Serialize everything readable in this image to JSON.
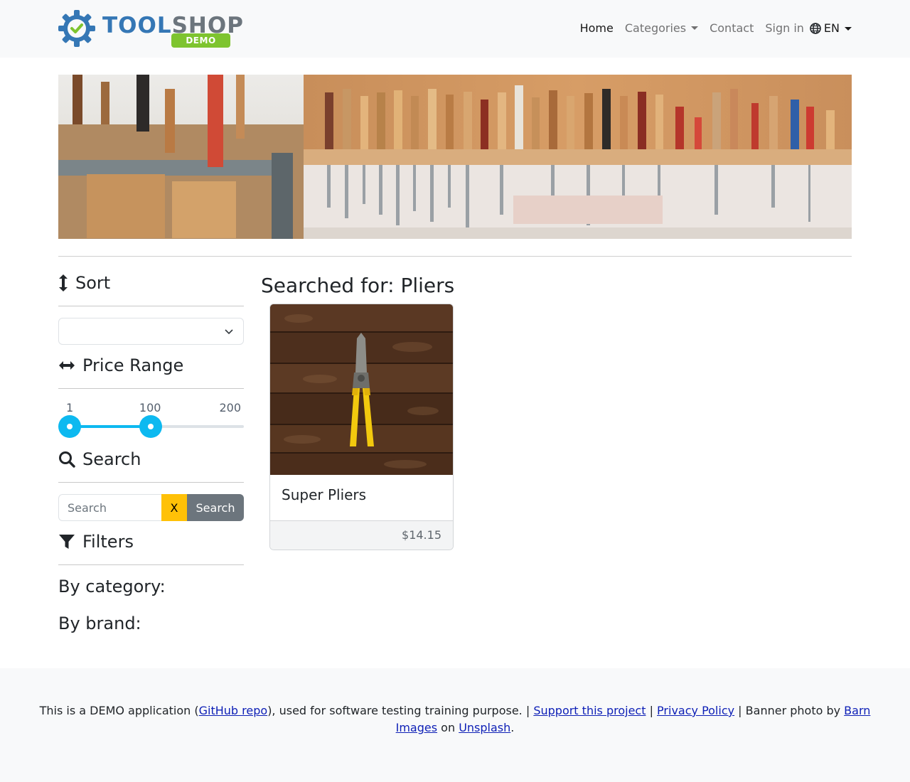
{
  "navbar": {
    "brand_text_1": "TOOL",
    "brand_text_2": "SHOP",
    "brand_badge": "DEMO",
    "links": {
      "home": "Home",
      "categories": "Categories",
      "contact": "Contact",
      "sign_in": "Sign in"
    },
    "language": "EN"
  },
  "sidebar": {
    "sort": {
      "heading": "Sort",
      "selected": ""
    },
    "price_range": {
      "heading": "Price Range",
      "min_label": "1",
      "max_label": "200",
      "current_label": "100",
      "range_min": 1,
      "range_max": 200,
      "selected_low": 1,
      "selected_high": 100
    },
    "search": {
      "heading": "Search",
      "placeholder": "Search",
      "value": "",
      "clear_label": "X",
      "submit_label": "Search"
    },
    "filters": {
      "heading": "Filters",
      "by_category": "By category:",
      "by_brand": "By brand:"
    }
  },
  "results": {
    "title": "Searched for: Pliers",
    "products": [
      {
        "name": "Super Pliers",
        "price": "$14.15"
      }
    ]
  },
  "footer": {
    "text_1": "This is a DEMO application (",
    "link_github": "GitHub repo",
    "text_2": "), used for software testing training purpose. | ",
    "link_support": "Support this project",
    "text_3": " | ",
    "link_privacy": "Privacy Policy",
    "text_4": " | Banner photo by ",
    "link_barn": "Barn Images",
    "text_5": " on ",
    "link_unsplash": "Unsplash",
    "text_6": "."
  },
  "colors": {
    "accent": "#0db9f0",
    "brand_blue": "#3577b5",
    "brand_green": "#7ec42f",
    "clear_button": "#ffc107",
    "search_button": "#6c757d"
  },
  "icons": {
    "logo": "gear-check-icon",
    "language": "globe-icon",
    "sort": "arrows-vertical-icon",
    "price_range": "arrows-horizontal-icon",
    "search": "magnifier-icon",
    "filters": "funnel-icon",
    "select": "chevron-down-icon"
  }
}
